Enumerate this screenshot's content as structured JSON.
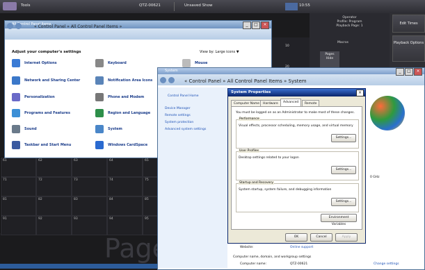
{
  "topbar": {
    "tools": "Tools",
    "qtz": "QTZ-00621",
    "unsaved": "Unsaved Show",
    "time": "10:55"
  },
  "operator": {
    "label": "Operator",
    "profile": "Profile: Program",
    "playback": "Playback Page: 1",
    "col_10": "10",
    "col_20": "20",
    "macros": "Macros",
    "pages_hide": "Pages\nHide"
  },
  "right_panel": {
    "edit_times": "Edit Times",
    "playback_options": "Playback Options"
  },
  "control_panel": {
    "title": "All Control Panel Items",
    "breadcrumb": "« Control Panel » All Control Panel Items »",
    "heading": "Adjust your computer's settings",
    "view_by_label": "View by:",
    "view_by_value": "Large icons ▼",
    "items": [
      {
        "label": "Internet Options"
      },
      {
        "label": "Keyboard"
      },
      {
        "label": "Mouse"
      },
      {
        "label": "Network and Sharing Center"
      },
      {
        "label": "Notification Area Icons"
      },
      {
        "label": "Personalization"
      },
      {
        "label": "Phone and Modem"
      },
      {
        "label": "Programs and Features"
      },
      {
        "label": "Region and Language"
      },
      {
        "label": "Sound"
      },
      {
        "label": "System"
      },
      {
        "label": "Taskbar and Start Menu"
      },
      {
        "label": "Windows CardSpace"
      }
    ]
  },
  "grid": {
    "cells": [
      "61",
      "62",
      "63",
      "64",
      "65",
      "71",
      "72",
      "73",
      "74",
      "75",
      "81",
      "82",
      "83",
      "84",
      "85",
      "91",
      "92",
      "93",
      "94",
      "95"
    ],
    "page_text": "Page"
  },
  "system_window": {
    "title": "System",
    "breadcrumb": "« Control Panel » All Control Panel Items » System",
    "home": "Control Panel Home",
    "links": [
      "Device Manager",
      "Remote settings",
      "System protection",
      "Advanced system settings"
    ],
    "ghz": "0 GHz",
    "website_label": "Website:",
    "website_value": "Online support",
    "section": "Computer name, domain, and workgroup settings",
    "computer_name_label": "Computer name:",
    "computer_name_value": "QTZ-00621",
    "change_settings": "Change settings"
  },
  "dialog": {
    "title": "System Properties",
    "tabs": [
      "Computer Name",
      "Hardware",
      "Advanced",
      "Remote"
    ],
    "admin_note": "You must be logged on as an Administrator to make most of these changes.",
    "performance_title": "Performance",
    "performance_text": "Visual effects, processor scheduling, memory usage, and virtual memory",
    "user_profiles_title": "User Profiles",
    "user_profiles_text": "Desktop settings related to your logon",
    "startup_title": "Startup and Recovery",
    "startup_text": "System startup, system failure, and debugging information",
    "settings": "Settings...",
    "env_vars": "Environment Variables",
    "ok": "OK",
    "cancel": "Cancel",
    "apply": "Apply"
  }
}
